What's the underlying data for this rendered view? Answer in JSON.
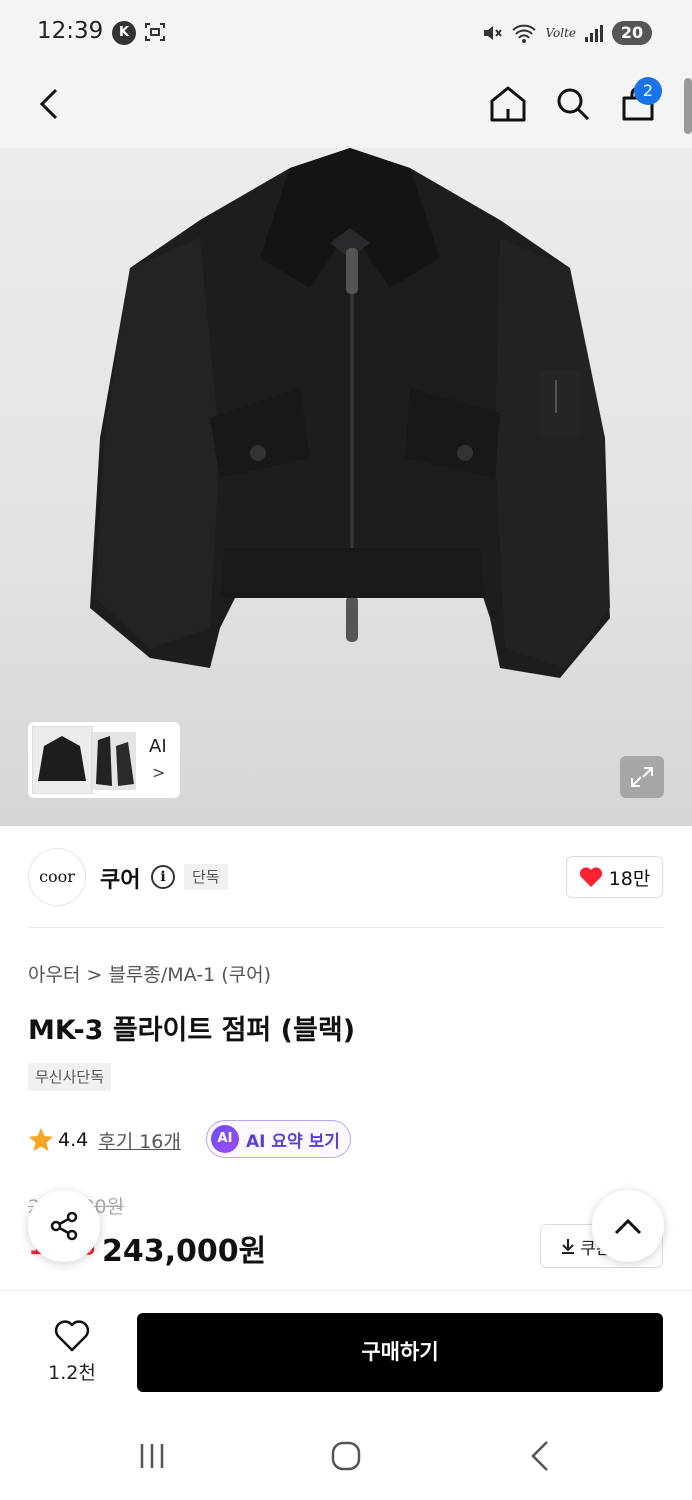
{
  "status_bar": {
    "time": "12:39",
    "k_icon": "K",
    "volte": "Volte",
    "battery": "20"
  },
  "header": {
    "cart_count": "2"
  },
  "gallery": {
    "ai_label": "AI",
    "ai_arrow": ">"
  },
  "brand": {
    "logo_text": "coor",
    "name": "쿠어",
    "info": "i",
    "exclusive": "단독",
    "likes": "18만"
  },
  "product": {
    "breadcrumb": "아우터 > 블루종/MA-1 (쿠어)",
    "title": "MK-3 플라이트 점퍼 (블랙)",
    "tag": "무신사단독",
    "rating": "4.4",
    "reviews": "후기 16개",
    "ai_badge": "AI",
    "ai_summary": "AI 요약 보기",
    "original_price": "270,000원",
    "discount": "10%",
    "price": "243,000원",
    "coupon": "쿠폰받기"
  },
  "bottom": {
    "wish_count": "1.2천",
    "buy_label": "구매하기"
  },
  "colors": {
    "accent_red": "#ff2233",
    "badge_blue": "#1a73e8",
    "ai_purple": "#6a4cf5"
  }
}
